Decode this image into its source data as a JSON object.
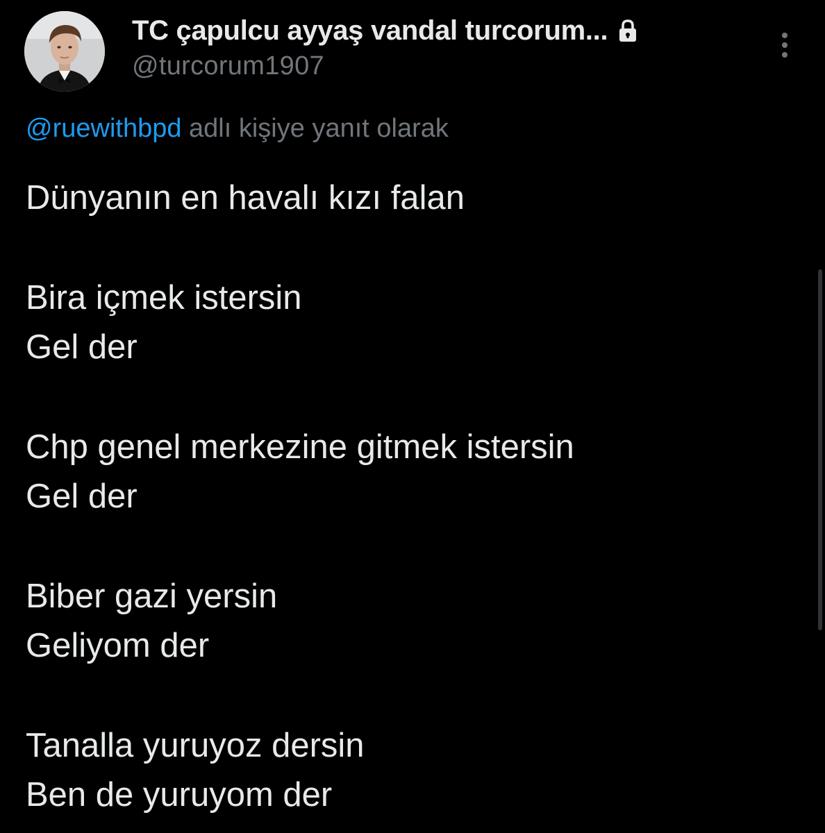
{
  "author": {
    "display_name": "TC çapulcu ayyaş vandal turcorum...",
    "handle": "@turcorum1907",
    "avatar_icon": "profile-photo",
    "protected_icon": "lock-icon"
  },
  "reply_context": {
    "mention": "@ruewithbpd",
    "suffix": " adlı kişiye yanıt olarak"
  },
  "tweet": {
    "line_1": "Dünyanın en havalı kızı falan",
    "line_2": "Bira içmek istersin",
    "line_3": "Gel der",
    "line_4": "Chp genel merkezine gitmek istersin",
    "line_5": "Gel der",
    "line_6": "Biber gazi yersin",
    "line_7": "Geliyom der",
    "line_8": "Tanalla yuruyoz dersin",
    "line_9": "Ben de yuruyom der"
  },
  "colors": {
    "background": "#000000",
    "text_primary": "#e7e9ea",
    "text_secondary": "#71767b",
    "link": "#1d9bf0"
  }
}
